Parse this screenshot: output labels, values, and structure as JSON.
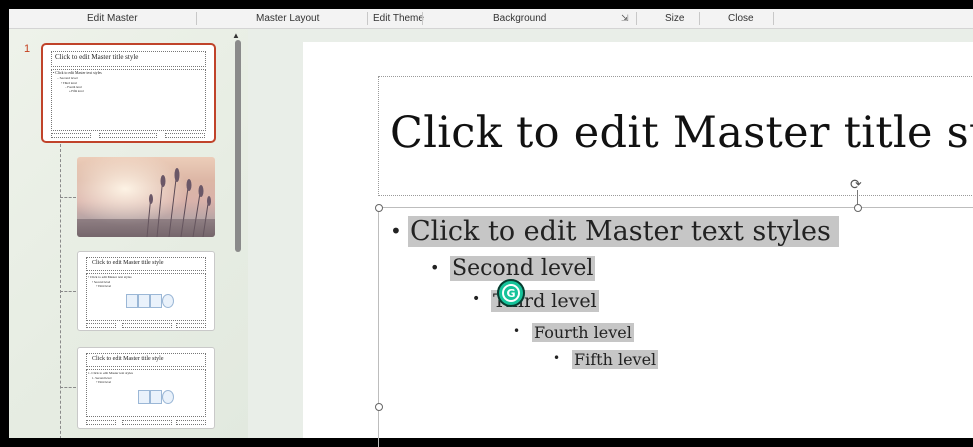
{
  "ribbon": {
    "groups": [
      "Edit Master",
      "Master Layout",
      "Edit Theme",
      "Background",
      "Size",
      "Close"
    ],
    "launcher_icon": "dialog-launcher-icon"
  },
  "thumbnails": {
    "slide_number": "1",
    "master": {
      "title": "Click to edit Master title style",
      "levels": [
        "• Click to edit Master text styles",
        "– Second level",
        "• Third level",
        "– Fourth level",
        "» Fifth level"
      ]
    },
    "layout2": {
      "title": "Click to edit Master title style",
      "levels": [
        "• Click to edit Master text styles",
        "• Second level",
        "• Third level"
      ]
    },
    "layout3": {
      "title": "Click to edit Master title style",
      "levels": [
        "1. Click to edit Master text styles",
        "1. Second level",
        "• Third level"
      ]
    }
  },
  "slide": {
    "title": "Click to edit Master title sty",
    "levels": [
      "Click to edit Master text styles",
      "Second level",
      "Third level",
      "Fourth level",
      "Fifth level"
    ],
    "bullet": "•"
  },
  "grammarly": {
    "glyph": "G"
  },
  "colors": {
    "accent_selected": "#c0432a",
    "highlight": "#c6c6c6",
    "grammarly": "#15c39a"
  }
}
